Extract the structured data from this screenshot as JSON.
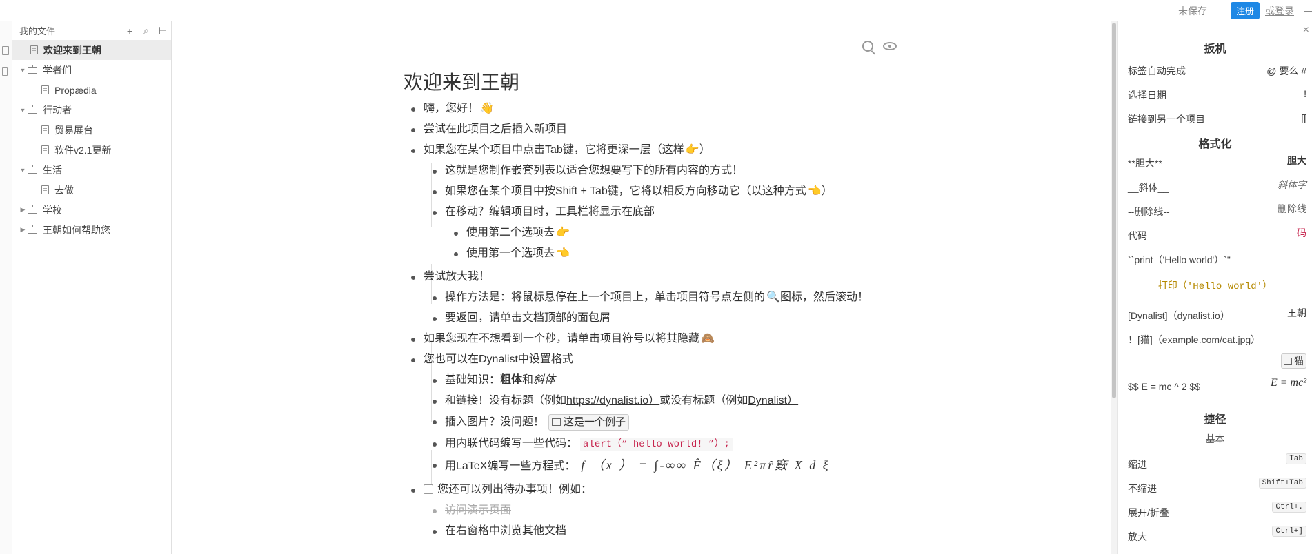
{
  "topbar": {
    "unsaved": "未保存",
    "register": "注册",
    "login": "或登录"
  },
  "tree": {
    "title": "我的文件",
    "add": "+",
    "search": "⌕",
    "collapse": "⊢",
    "items": [
      {
        "label": "欢迎来到王朝",
        "type": "file",
        "level": 0,
        "active": true
      },
      {
        "label": "学者们",
        "type": "folder",
        "level": 0,
        "expanded": true
      },
      {
        "label": "Propædia",
        "type": "file",
        "level": 1
      },
      {
        "label": "行动者",
        "type": "folder",
        "level": 0,
        "expanded": true
      },
      {
        "label": "贸易展台",
        "type": "file",
        "level": 1
      },
      {
        "label": "软件v2.1更新",
        "type": "file",
        "level": 1
      },
      {
        "label": "生活",
        "type": "folder",
        "level": 0,
        "expanded": true
      },
      {
        "label": "去做",
        "type": "file",
        "level": 1
      },
      {
        "label": "学校",
        "type": "folder",
        "level": 0,
        "expanded": false
      },
      {
        "label": "王朝如何帮助您",
        "type": "folder",
        "level": 0,
        "expanded": false
      }
    ]
  },
  "doc": {
    "title": "欢迎来到王朝",
    "items": {
      "i1": "嗨，您好！",
      "i2": "尝试在此项目之后插入新项目",
      "i3": "如果您在某个项目中点击Tab键，它将更深一层（这样",
      "i3_end": "）",
      "i3a": "这就是您制作嵌套列表以适合您想要写下的所有内容的方式！",
      "i3b": "如果您在某个项目中按Shift + Tab键，它将以相反方向移动它（以这种方式",
      "i3b_end": "）",
      "i3c": "在移动？编辑项目时，工具栏将显示在底部",
      "i3c1": "使用第二个选项去",
      "i3c2": "使用第一个选项去",
      "i4": "尝试放大我！",
      "i4a": "操作方法是：将鼠标悬停在上一个项目上，单击项目符号点左侧的",
      "i4a_end": "图标，然后滚动！",
      "i4b": "要返回，请单击文档顶部的面包屑",
      "i5": "如果您现在不想看到一个秒，请单击项目符号以将其隐藏",
      "i6": "您也可以在Dynalist中设置格式",
      "i6a_pre": "基础知识：",
      "i6a_bold": "粗体",
      "i6a_mid": "和",
      "i6a_italic": "斜体",
      "i6b_pre": "和链接！没有标题（例如",
      "i6b_link1": "https://dynalist.io）",
      "i6b_mid": "或没有标题（例如",
      "i6b_link2": "Dynalist）",
      "i6c": "插入图片？没问题！",
      "i6c_img": "这是一个例子",
      "i6d": "用内联代码编写一些代码：",
      "i6d_code": "alert（“ hello world! ”）;",
      "i6e": "用LaTeX编写一些方程式：",
      "i6e_latex": "f （x ） = ∫-∞∞ F̂（ξ） E²πȓ窽 X d ξ",
      "i7": "您还可以列出待办事项！例如：",
      "i7a": "访问演示页面",
      "i7b": "在右窗格中浏览其他文档"
    },
    "emoji": {
      "wave": "👋",
      "right": "👉",
      "left": "👈",
      "magnifier": "🔍",
      "monkey": "🙈"
    }
  },
  "help": {
    "close": "×",
    "s1": "扳机",
    "r1": {
      "l": "标签自动完成",
      "r": "@ 要么 #"
    },
    "r2": {
      "l": "选择日期",
      "r": "!"
    },
    "r3": {
      "l": "链接到另一个项目",
      "r": "[["
    },
    "s2": "格式化",
    "r4": {
      "l": "**胆大**",
      "r": "胆大"
    },
    "r5": {
      "l": "__斜体__",
      "r": "斜体字"
    },
    "r6": {
      "l": "--删除线--",
      "r": "删除线"
    },
    "r7": {
      "l": "代码",
      "r": "码"
    },
    "r8": {
      "l": "``print（'Hello world'）`\"",
      "r": ""
    },
    "r8b": "打印（'Hello world'）",
    "r9": {
      "l": "[Dynalist]（dynalist.io）",
      "r": "王朝"
    },
    "r10": {
      "l": "！[猫]（example.com/cat.jpg）",
      "r": ""
    },
    "r10b": "猫",
    "r11": {
      "l": "$$ E = mc ^ 2 $$",
      "r": "E = mc²"
    },
    "s3": "捷径",
    "s3sub": "基本",
    "k1": {
      "l": "缩进",
      "r": "Tab"
    },
    "k2": {
      "l": "不缩进",
      "r": "Shift+Tab"
    },
    "k3": {
      "l": "展开/折叠",
      "r": "Ctrl+."
    },
    "k4": {
      "l": "放大",
      "r": "Ctrl+]"
    }
  }
}
